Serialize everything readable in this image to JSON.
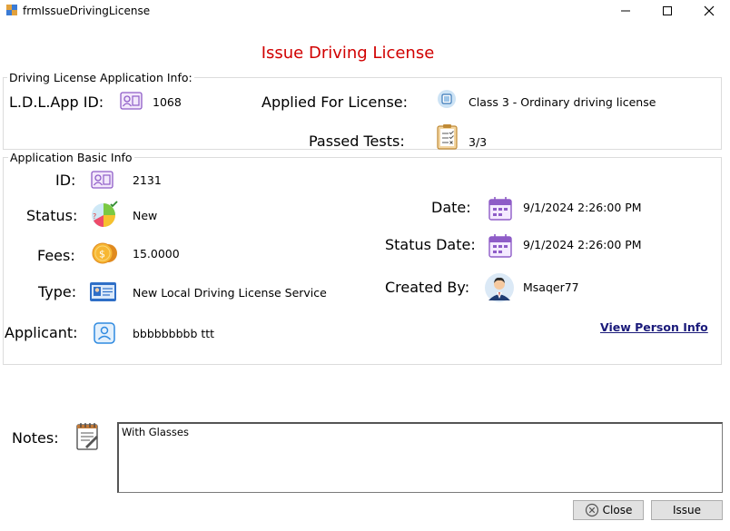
{
  "window": {
    "title": "frmIssueDrivingLicense"
  },
  "form_title": "Issue Driving License",
  "ldl_group": {
    "title": "Driving License Application Info:",
    "ldl_app_id_label": "L.D.L.App ID:",
    "ldl_app_id_value": "1068",
    "applied_for_label": "Applied For License:",
    "applied_for_value": "Class 3 - Ordinary driving license",
    "passed_tests_label": "Passed Tests:",
    "passed_tests_value": "3/3"
  },
  "basic_group": {
    "title": "Application Basic Info",
    "id_label": "ID:",
    "id_value": "2131",
    "status_label": "Status:",
    "status_value": "New",
    "fees_label": "Fees:",
    "fees_value": "15.0000",
    "type_label": "Type:",
    "type_value": "New Local Driving License Service",
    "applicant_label": "Applicant:",
    "applicant_value": "bbbbbbbbb ttt",
    "date_label": "Date:",
    "date_value": "9/1/2024 2:26:00 PM",
    "status_date_label": "Status Date:",
    "status_date_value": "9/1/2024 2:26:00 PM",
    "created_by_label": "Created By:",
    "created_by_value": "Msaqer77",
    "view_person_link": "View Person Info"
  },
  "notes": {
    "label": "Notes:",
    "value": "With Glasses"
  },
  "buttons": {
    "close_label": "Close",
    "issue_label": "Issue"
  },
  "colors": {
    "title_red": "#d10000",
    "link_blue": "#1a1a7a"
  }
}
